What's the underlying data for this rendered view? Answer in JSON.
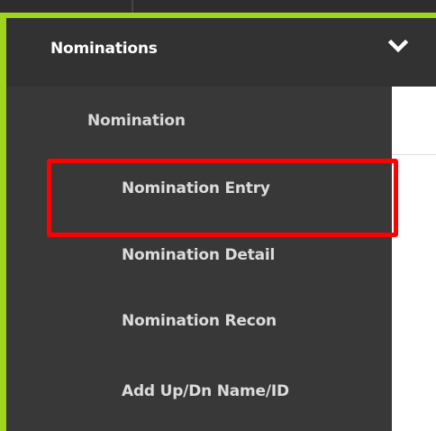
{
  "menu": {
    "section_title": "Nominations",
    "section_expanded": true,
    "subheader": "Nomination",
    "items": [
      {
        "label": "Nomination Entry",
        "highlighted": true
      },
      {
        "label": "Nomination Detail",
        "highlighted": false
      },
      {
        "label": "Nomination Recon",
        "highlighted": false
      },
      {
        "label": "Add Up/Dn Name/ID",
        "highlighted": false
      }
    ]
  },
  "icons": {
    "expand": "chevron-down-icon"
  },
  "colors": {
    "accent": "#9fd41f",
    "menu_background": "#383838",
    "header_background": "#323232",
    "highlight": "#ff0000",
    "text": "#dcdcdc"
  }
}
